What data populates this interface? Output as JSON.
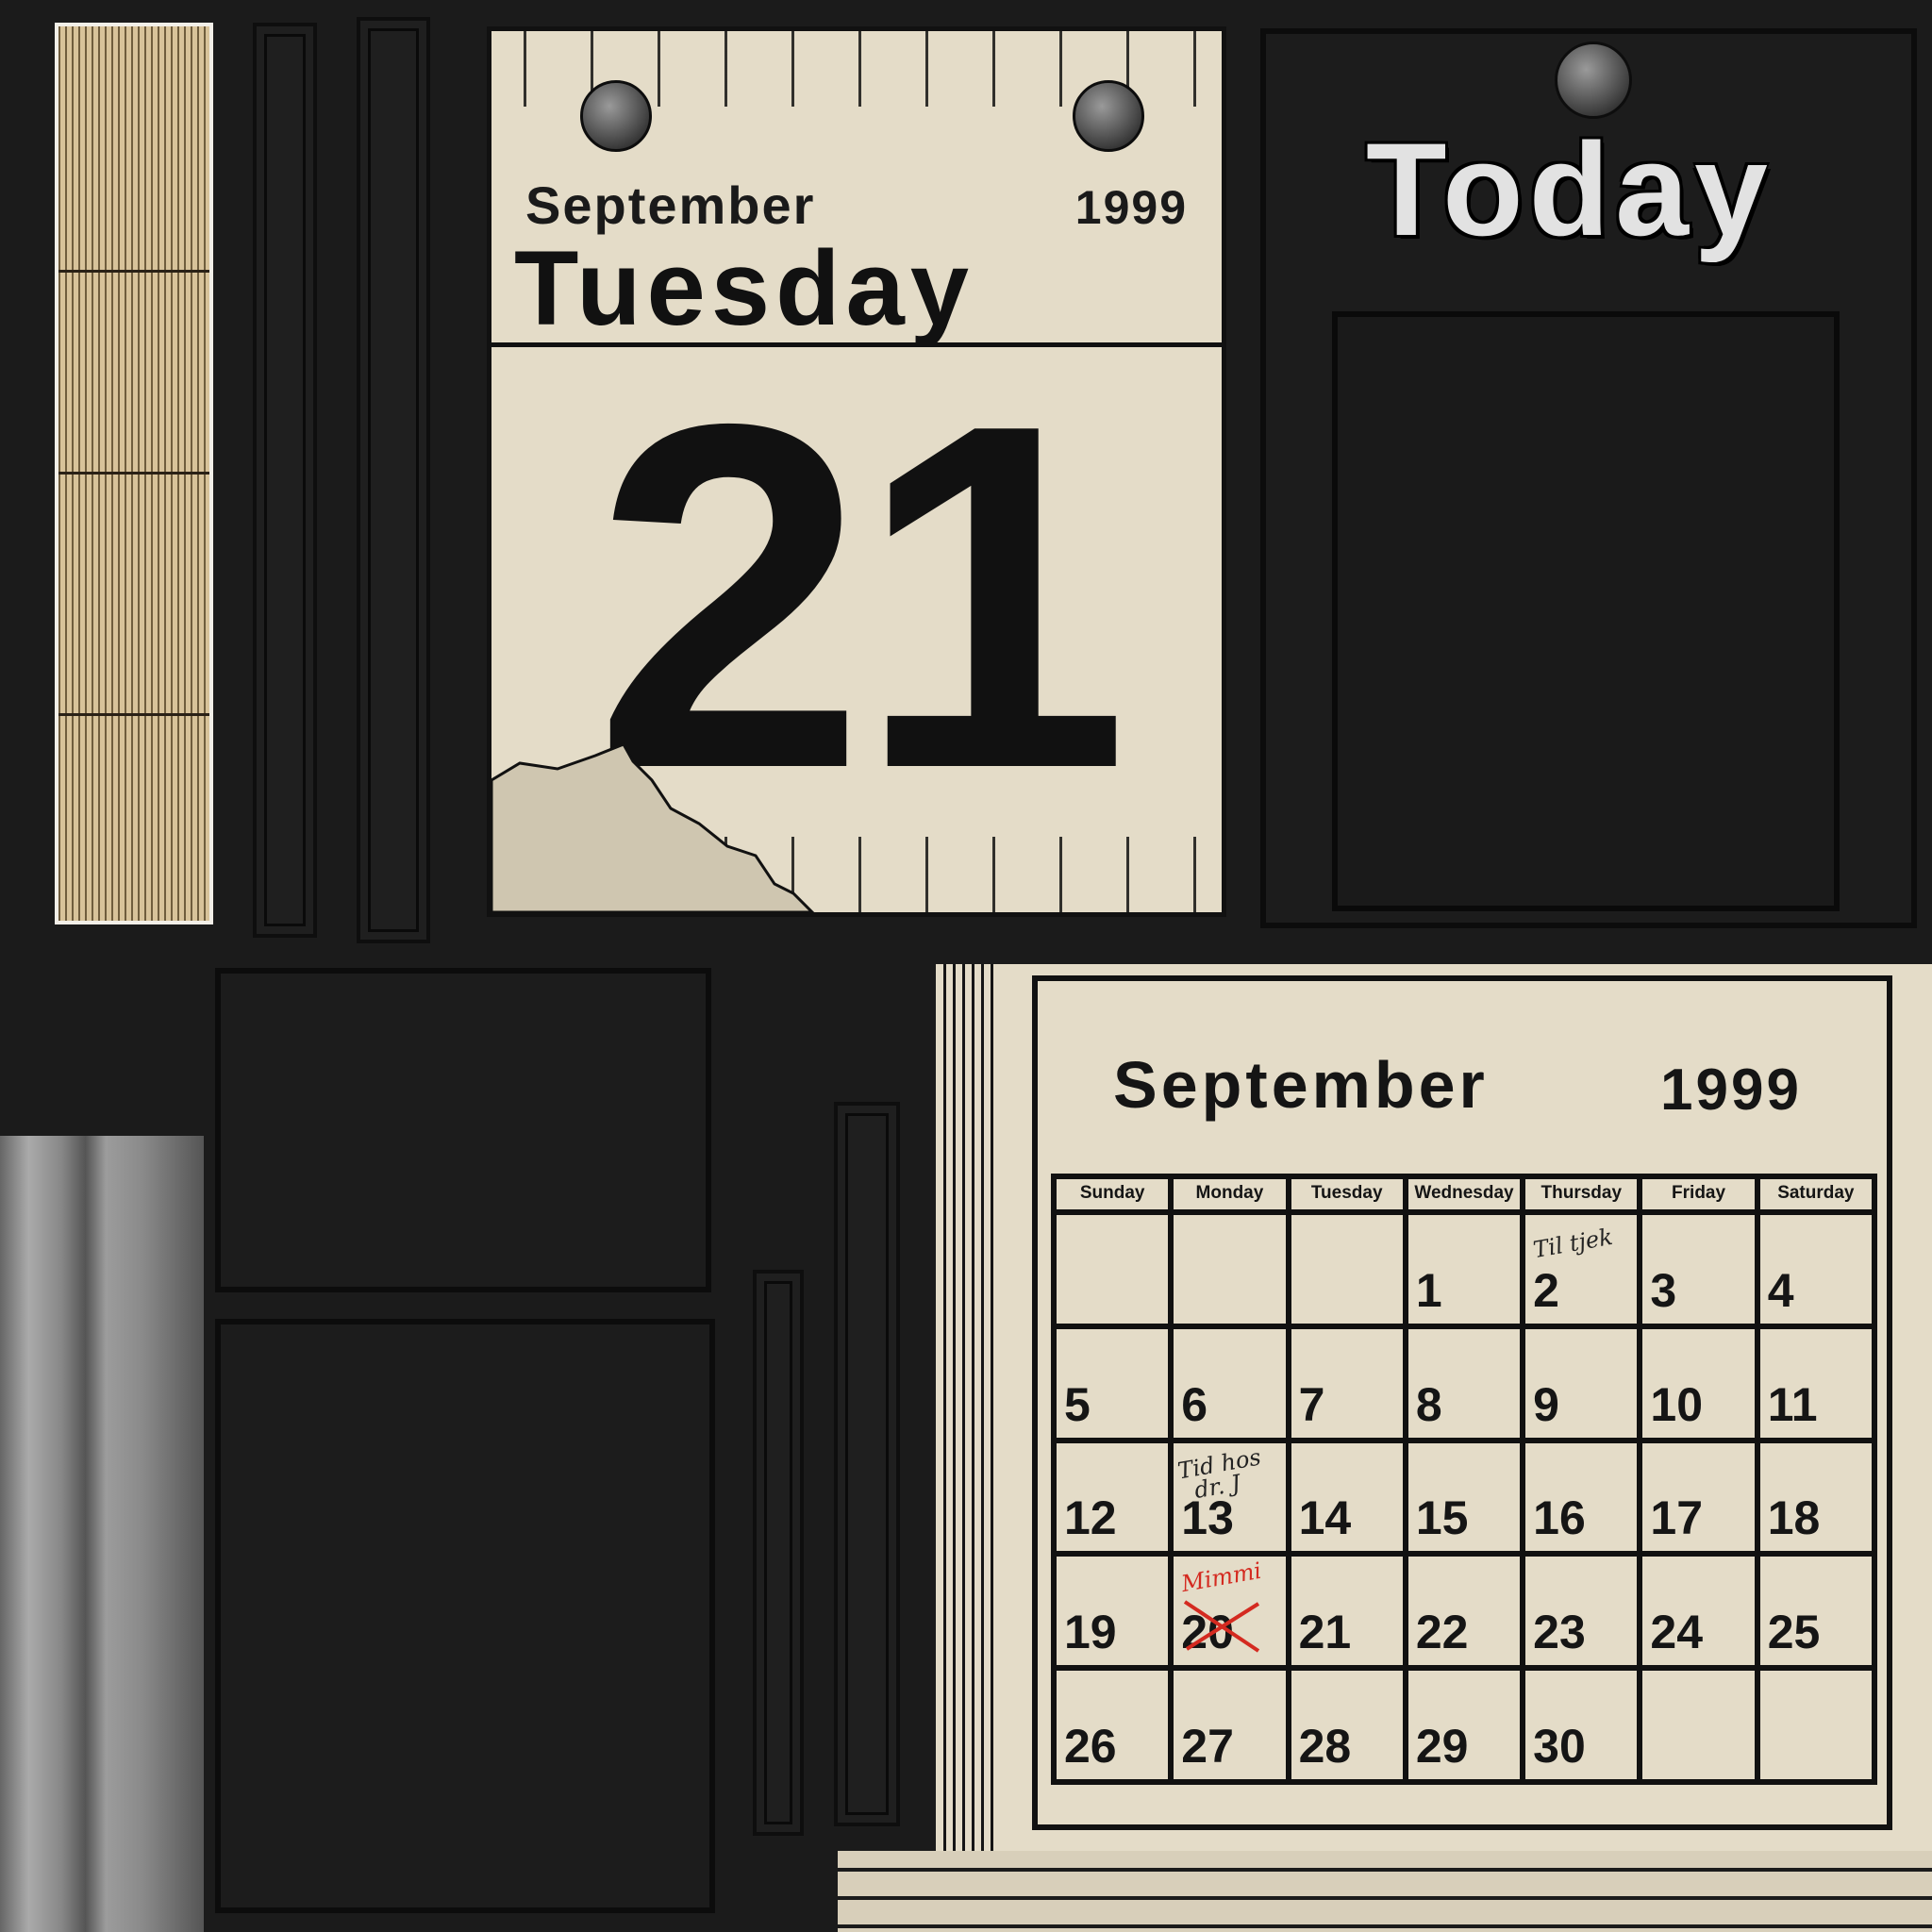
{
  "daily_page": {
    "month": "September",
    "year": "1999",
    "weekday": "Tuesday",
    "day": "21"
  },
  "today_panel": {
    "label": "Today"
  },
  "monthly_calendar": {
    "month": "September",
    "year": "1999",
    "weekdays": [
      "Sunday",
      "Monday",
      "Tuesday",
      "Wednesday",
      "Thursday",
      "Friday",
      "Saturday"
    ],
    "weeks": [
      [
        "",
        "",
        "",
        "1",
        "2",
        "3",
        "4"
      ],
      [
        "5",
        "6",
        "7",
        "8",
        "9",
        "10",
        "11"
      ],
      [
        "12",
        "13",
        "14",
        "15",
        "16",
        "17",
        "18"
      ],
      [
        "19",
        "20",
        "21",
        "22",
        "23",
        "24",
        "25"
      ],
      [
        "26",
        "27",
        "28",
        "29",
        "30",
        "",
        ""
      ]
    ],
    "notes": {
      "thursday_2": "Til tjek",
      "monday_13_line1": "Tid hos",
      "monday_13_line2": "dr. J",
      "monday_20": "Mimmi"
    },
    "crossed_out_day": "20"
  },
  "colors": {
    "paper": "#e4dcc8",
    "ink": "#111111",
    "background": "#1b1b1b",
    "note_red": "#d42a20"
  }
}
